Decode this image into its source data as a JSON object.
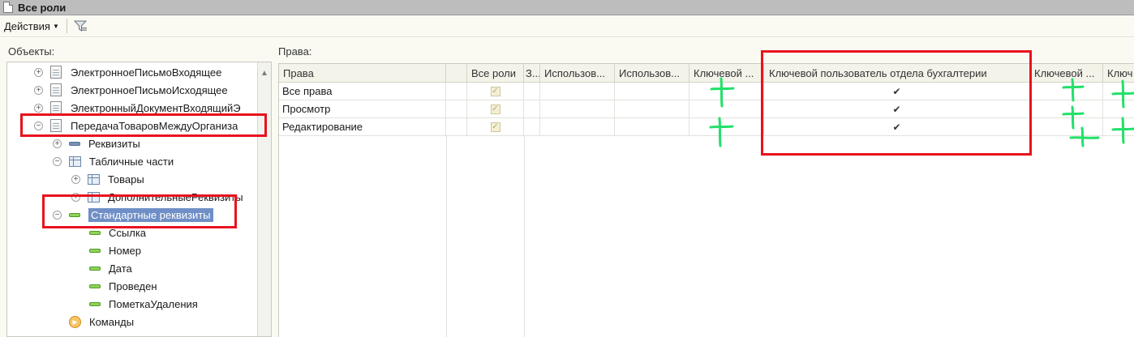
{
  "window": {
    "title": "Все роли"
  },
  "toolbar": {
    "actions_label": "Действия",
    "filter_icon": "filter-icon"
  },
  "objects_panel": {
    "label": "Объекты:",
    "items": [
      {
        "label": "ЭлектронноеПисьмоВходящее",
        "icon": "document-icon",
        "expander": "+"
      },
      {
        "label": "ЭлектронноеПисьмоИсходящее",
        "icon": "document-icon",
        "expander": "+"
      },
      {
        "label": "ЭлектронныйДокументВходящийЭ",
        "icon": "document-icon",
        "expander": "+"
      },
      {
        "label": "ПередачаТоваровМеждуОрганиза",
        "icon": "document-icon",
        "expander": "−"
      },
      {
        "label": "Реквизиты",
        "icon": "attribute-icon",
        "expander": "+"
      },
      {
        "label": "Табличные части",
        "icon": "table-icon",
        "expander": "−"
      },
      {
        "label": "Товары",
        "icon": "table-icon",
        "expander": "+"
      },
      {
        "label": "ДополнительныеРеквизиты",
        "icon": "table-icon",
        "expander": "+"
      },
      {
        "label": "Стандартные реквизиты",
        "icon": "attribute-icon",
        "expander": "−"
      },
      {
        "label": "Ссылка",
        "icon": "attribute-icon"
      },
      {
        "label": "Номер",
        "icon": "attribute-icon"
      },
      {
        "label": "Дата",
        "icon": "attribute-icon"
      },
      {
        "label": "Проведен",
        "icon": "attribute-icon"
      },
      {
        "label": "ПометкаУдаления",
        "icon": "attribute-icon"
      },
      {
        "label": "Команды",
        "icon": "command-icon"
      }
    ]
  },
  "rights_panel": {
    "label": "Права:",
    "columns": [
      "Права",
      "",
      "Все роли",
      "З...",
      "Использов...",
      "Использов...",
      "Ключевой ...",
      "Ключевой пользователь отдела бухгалтерии",
      "Ключевой ...",
      "Ключ"
    ],
    "rows": [
      {
        "name": "Все права",
        "all_roles": "✓",
        "key_accounting": "✔"
      },
      {
        "name": "Просмотр",
        "all_roles": "✓",
        "key_accounting": "✔"
      },
      {
        "name": "Редактирование",
        "all_roles": "✓",
        "key_accounting": "✔"
      }
    ]
  },
  "colors": {
    "annotation_red": "#e8121d",
    "annotation_green": "#22e06a",
    "selection": "#6f8fc6",
    "panel_bg": "#fbfaf2"
  }
}
